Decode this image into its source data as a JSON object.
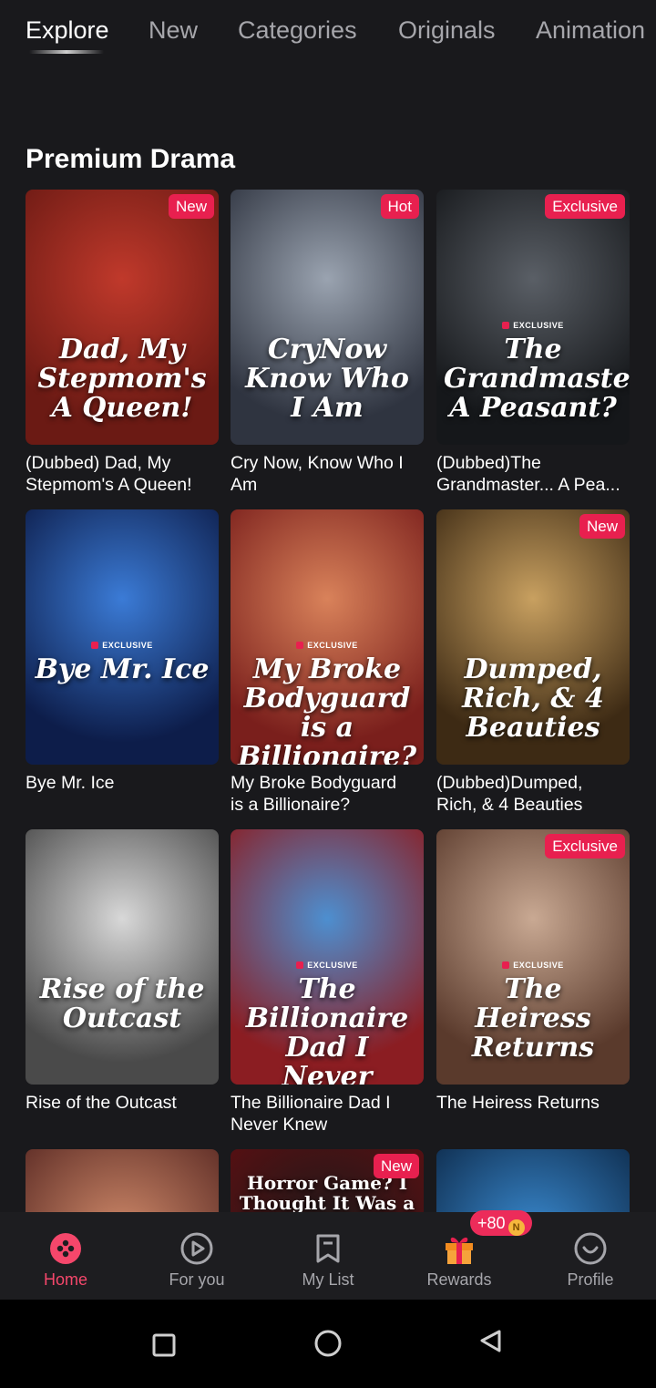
{
  "tabs": [
    {
      "label": "Explore",
      "active": true
    },
    {
      "label": "New"
    },
    {
      "label": "Categories"
    },
    {
      "label": "Originals"
    },
    {
      "label": "Animation"
    }
  ],
  "section": {
    "title": "Premium Drama"
  },
  "cards": [
    {
      "title": "(Dubbed) Dad, My\nStepmom's A Queen!",
      "badge": "New",
      "poster_text": "Dad, My Stepmom's A Queen!",
      "exclusive_mark": "",
      "colors": [
        "#c0392b",
        "#6b1a14"
      ]
    },
    {
      "title": "Cry Now, Know Who I\nAm",
      "badge": "Hot",
      "poster_text": "CryNow Know Who I Am",
      "exclusive_mark": "",
      "colors": [
        "#9aa3b0",
        "#2f3440"
      ]
    },
    {
      "title": "(Dubbed)The\nGrandmaster... A Pea...",
      "badge": "Exclusive",
      "poster_text": "The Grandmaster... A Peasant?",
      "exclusive_mark": "EXCLUSIVE",
      "colors": [
        "#5a5f66",
        "#15171a"
      ]
    },
    {
      "title": "Bye Mr. Ice",
      "badge": "",
      "poster_text": "Bye Mr. Ice",
      "exclusive_mark": "EXCLUSIVE",
      "colors": [
        "#3b7bd6",
        "#0d1d4a"
      ]
    },
    {
      "title": "My Broke Bodyguard\nis a Billionaire?",
      "badge": "",
      "poster_text": "My Broke Bodyguard is a Billionaire?",
      "exclusive_mark": "EXCLUSIVE",
      "colors": [
        "#d9825a",
        "#7a1f1c"
      ]
    },
    {
      "title": "(Dubbed)Dumped,\nRich, & 4 Beauties",
      "badge": "New",
      "poster_text": "Dumped, Rich, & 4 Beauties",
      "exclusive_mark": "",
      "colors": [
        "#c8a060",
        "#3d2a14"
      ]
    },
    {
      "title": "Rise of the Outcast",
      "badge": "",
      "poster_text": "Rise of the Outcast",
      "exclusive_mark": "",
      "colors": [
        "#d8d8d8",
        "#4a4a4a"
      ]
    },
    {
      "title": "The Billionaire Dad I\nNever Knew",
      "badge": "",
      "poster_text": "The Billionaire Dad I Never Knew",
      "exclusive_mark": "EXCLUSIVE",
      "colors": [
        "#4d8fd0",
        "#8b1d22"
      ]
    },
    {
      "title": "The Heiress Returns",
      "badge": "Exclusive",
      "poster_text": "The Heiress Returns",
      "exclusive_mark": "EXCLUSIVE",
      "colors": [
        "#c9a993",
        "#5a3a2c"
      ]
    },
    {
      "title": "",
      "badge": "",
      "poster_text": "",
      "exclusive_mark": "",
      "colors": [
        "#d08a6a",
        "#5a2a24"
      ]
    },
    {
      "title": "",
      "badge": "New",
      "poster_text": "Horror Game? I Thought It Was a",
      "exclusive_mark": "",
      "colors": [
        "#1a1a1a",
        "#5a0f12"
      ]
    },
    {
      "title": "",
      "badge": "",
      "poster_text": "",
      "exclusive_mark": "",
      "colors": [
        "#3a8ad0",
        "#0d2a4a"
      ]
    }
  ],
  "nav": [
    {
      "label": "Home",
      "icon": "home-icon",
      "active": true
    },
    {
      "label": "For you",
      "icon": "play-circle-icon"
    },
    {
      "label": "My List",
      "icon": "bookmark-icon"
    },
    {
      "label": "Rewards",
      "icon": "gift-icon",
      "pill": "+80",
      "coin": "N"
    },
    {
      "label": "Profile",
      "icon": "profile-icon"
    }
  ],
  "accent": "#e8204f"
}
